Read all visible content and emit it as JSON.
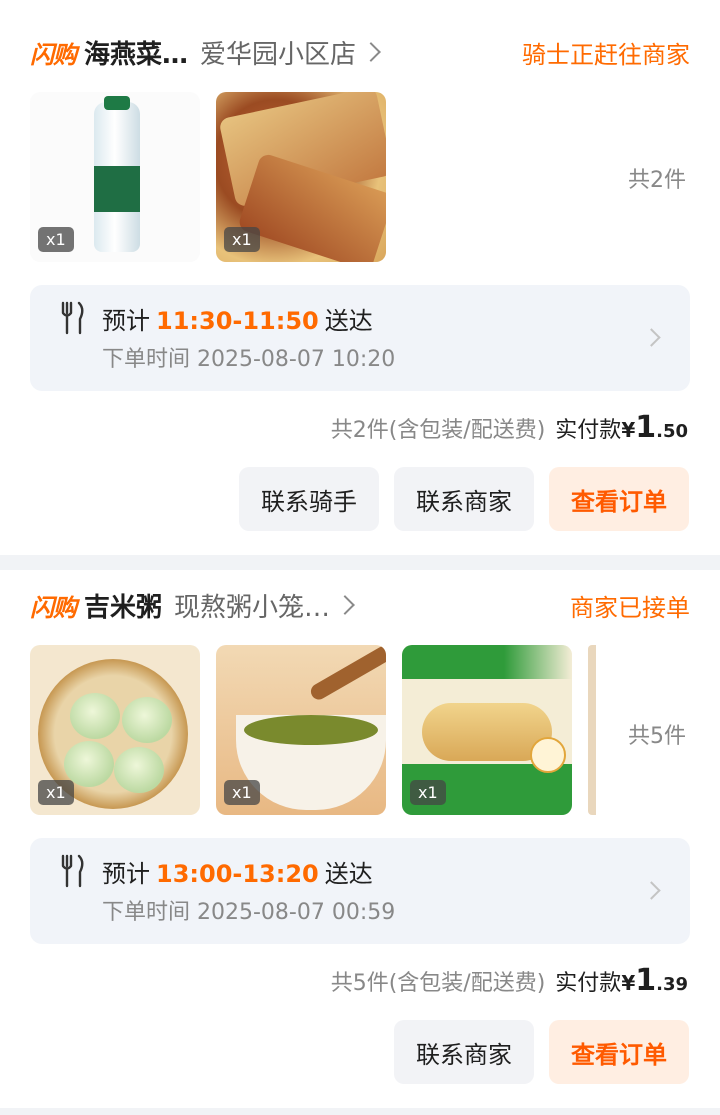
{
  "orders": [
    {
      "brand": "闪购",
      "shop_name": "海燕菜…",
      "branch": "爱华园小区店",
      "status": "骑士正赶往商家",
      "items": [
        {
          "qty": "x1",
          "image": "water-bottle"
        },
        {
          "qty": "x1",
          "image": "pancake-roll"
        }
      ],
      "count_label": "共2件",
      "delivery": {
        "prefix": "预计",
        "time": "11:30-11:50",
        "suffix": "送达",
        "order_time": "下单时间 2025-08-07 10:20"
      },
      "total_desc": "共2件(含包装/配送费)",
      "paid_label": "实付款",
      "currency": "¥",
      "amount_int": "1",
      "amount_dec": ".50",
      "buttons": [
        "联系骑手",
        "联系商家",
        "查看订单"
      ]
    },
    {
      "brand": "闪购",
      "shop_name": "吉米粥",
      "branch": "现熬粥小笼…",
      "status": "商家已接单",
      "items": [
        {
          "qty": "x1",
          "image": "steamed-buns"
        },
        {
          "qty": "x1",
          "image": "green-porridge"
        },
        {
          "qty": "x1",
          "image": "egg-wrap"
        }
      ],
      "count_label": "共5件",
      "delivery": {
        "prefix": "预计",
        "time": "13:00-13:20",
        "suffix": "送达",
        "order_time": "下单时间 2025-08-07 00:59"
      },
      "total_desc": "共5件(含包装/配送费)",
      "paid_label": "实付款",
      "currency": "¥",
      "amount_int": "1",
      "amount_dec": ".39",
      "buttons": [
        "联系商家",
        "查看订单"
      ]
    }
  ],
  "colors": {
    "accent": "#ff6a00",
    "primary_button_bg": "#ffeee2",
    "info_bg": "#f1f4f9"
  }
}
